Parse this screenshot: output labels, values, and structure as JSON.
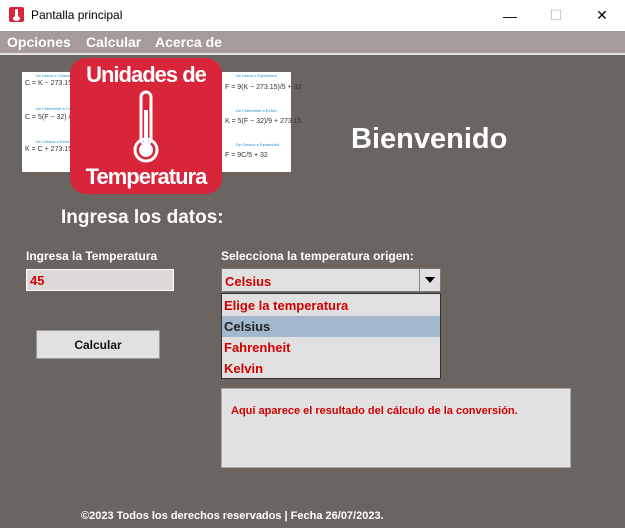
{
  "window": {
    "title": "Pantalla principal",
    "minimize_glyph": "—",
    "maximize_glyph": "☐",
    "close_glyph": "✕"
  },
  "menu": {
    "items": [
      "Opciones",
      "Calcular",
      "Acerca de"
    ]
  },
  "logo": {
    "line1": "Unidades de",
    "line2": "Temperatura",
    "icon": "thermometer-icon",
    "color": "#d9253a"
  },
  "formulas": {
    "left": [
      {
        "caption": "De Kelvin a Celsius",
        "text": "C = K − 273.15"
      },
      {
        "caption": "De Fahrenheit a Celsius",
        "text": "C = 5(F − 32) / 9"
      },
      {
        "caption": "De Celsius a Kelvin",
        "text": "K = C + 273.15"
      }
    ],
    "right": [
      {
        "caption": "De Kelvin a Fahrenheit",
        "text": "F = 9(K − 273.15)/5 + 32"
      },
      {
        "caption": "De Fahrenheit a Kelvin",
        "text": "K = 5(F − 32)/9 + 273.15"
      },
      {
        "caption": "De Celsius a Fahrenheit",
        "text": "F = 9C/5 + 32"
      }
    ]
  },
  "main": {
    "welcome": "Bienvenido",
    "subtitle": "Ingresa los datos:",
    "temp_label": "Ingresa la Temperatura",
    "temp_value": "45",
    "origin_label": "Selecciona la temperatura origen:",
    "origin_selected": "Celsius",
    "origin_options": [
      "Elige la temperatura",
      "Celsius",
      "Fahrenheit",
      "Kelvin"
    ],
    "calc_button": "Calcular",
    "result_text": "Aquí aparece el resultado del cálculo de la conversión."
  },
  "footer": {
    "text": "©2023 Todos los derechos reservados | Fecha 26/07/2023."
  },
  "colors": {
    "background": "#6b6562",
    "menubar": "#a79b9a",
    "accent_red": "#d10000",
    "selected_option": "#a3b8cc"
  }
}
